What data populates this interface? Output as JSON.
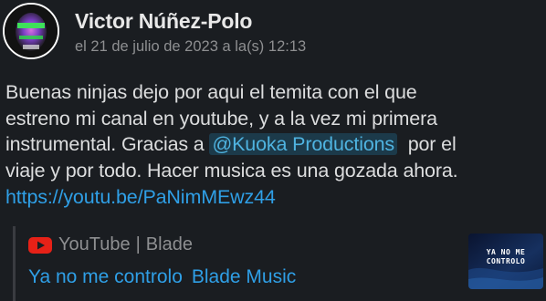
{
  "message": {
    "author": "Victor Núñez-Polo",
    "timestamp": "el 21 de julio de 2023 a la(s) 12:13",
    "avatar_icon": "user-avatar",
    "body": {
      "line1": "Buenas ninjas dejo por aqui el temita con el que",
      "line2": "estreno mi canal en youtube, y a la vez mi primera",
      "line3_prefix": "instrumental. Gracias a ",
      "mention": "@Kuoka Productions",
      "line3_suffix": "  por el",
      "line4": "viaje y por todo. Hacer musica es una gozada ahora.",
      "link": "https://youtu.be/PaNimMEwz44"
    }
  },
  "attachment": {
    "provider": "YouTube",
    "separator": "|",
    "channel": "Blade",
    "title": "Ya no me controlo",
    "author": "Blade Music",
    "provider_icon": "youtube-icon",
    "thumbnail_text": "YA NO ME CONTROLO",
    "colors": {
      "link": "#2f9fe6",
      "mention_bg": "#1c3a4a",
      "youtube_red": "#e62117",
      "background": "#1a1d21"
    }
  }
}
